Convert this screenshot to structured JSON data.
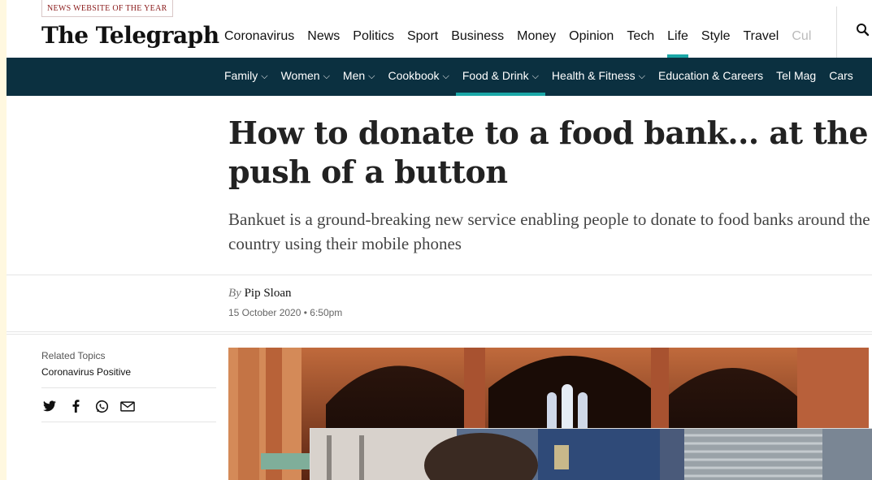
{
  "header": {
    "award_badge": "NEWS WEBSITE OF THE YEAR",
    "logo": "The Telegraph",
    "primary_nav": [
      {
        "label": "Coronavirus",
        "active": false
      },
      {
        "label": "News",
        "active": false
      },
      {
        "label": "Politics",
        "active": false
      },
      {
        "label": "Sport",
        "active": false
      },
      {
        "label": "Business",
        "active": false
      },
      {
        "label": "Money",
        "active": false
      },
      {
        "label": "Opinion",
        "active": false
      },
      {
        "label": "Tech",
        "active": false
      },
      {
        "label": "Life",
        "active": true
      },
      {
        "label": "Style",
        "active": false
      },
      {
        "label": "Travel",
        "active": false
      },
      {
        "label": "Cul",
        "active": false
      }
    ],
    "search_icon": "search-icon"
  },
  "sub_nav": [
    {
      "label": "Family",
      "dropdown": true,
      "active": false
    },
    {
      "label": "Women",
      "dropdown": true,
      "active": false
    },
    {
      "label": "Men",
      "dropdown": true,
      "active": false
    },
    {
      "label": "Cookbook",
      "dropdown": true,
      "active": false
    },
    {
      "label": "Food & Drink",
      "dropdown": true,
      "active": true
    },
    {
      "label": "Health & Fitness",
      "dropdown": true,
      "active": false
    },
    {
      "label": "Education & Careers",
      "dropdown": false,
      "active": false
    },
    {
      "label": "Tel Mag",
      "dropdown": false,
      "active": false
    },
    {
      "label": "Cars",
      "dropdown": false,
      "active": false
    }
  ],
  "article": {
    "headline": "How to donate to a food bank... at the push of a button",
    "standfirst": "Bankuet is a ground-breaking new service enabling people to donate to food banks around the country using their mobile phones",
    "byline_prefix": "By",
    "author": "Pip Sloan",
    "date": "15 October 2020 • 6:50pm"
  },
  "sidebar": {
    "related_label": "Related Topics",
    "related_topic": "Coronavirus Positive",
    "share_icons": [
      "twitter-icon",
      "facebook-icon",
      "whatsapp-icon",
      "email-icon"
    ]
  },
  "colors": {
    "accent": "#1aa7a7",
    "subnav_bg": "#0b3040",
    "award_text": "#8a1a1a",
    "page_outer": "#fff8e0"
  }
}
